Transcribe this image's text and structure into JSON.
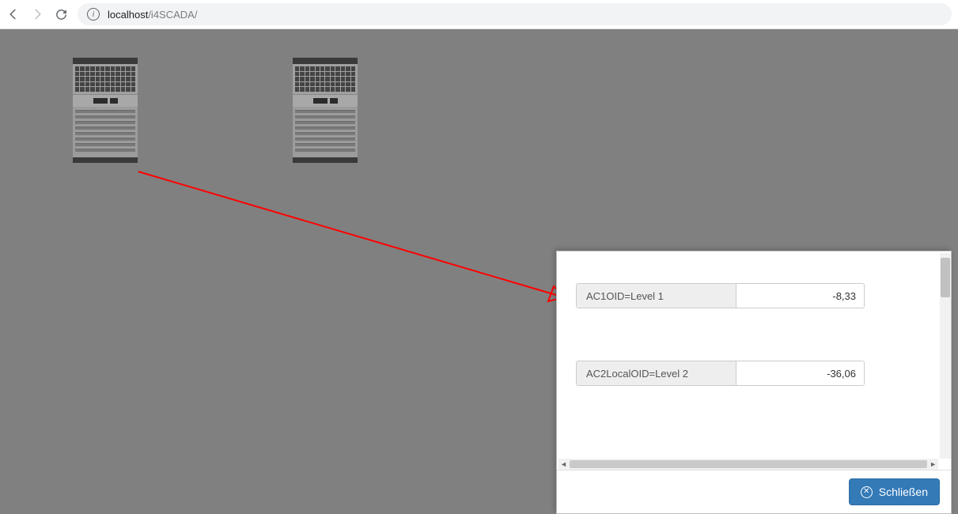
{
  "browser": {
    "url_host": "localhost",
    "url_path": "/i4SCADA/"
  },
  "popup": {
    "rows": [
      {
        "label": "AC1OID=Level 1",
        "value": "-8,33"
      },
      {
        "label": "AC2LocalOID=Level 2",
        "value": "-36,06"
      }
    ],
    "close_label": "Schließen"
  }
}
